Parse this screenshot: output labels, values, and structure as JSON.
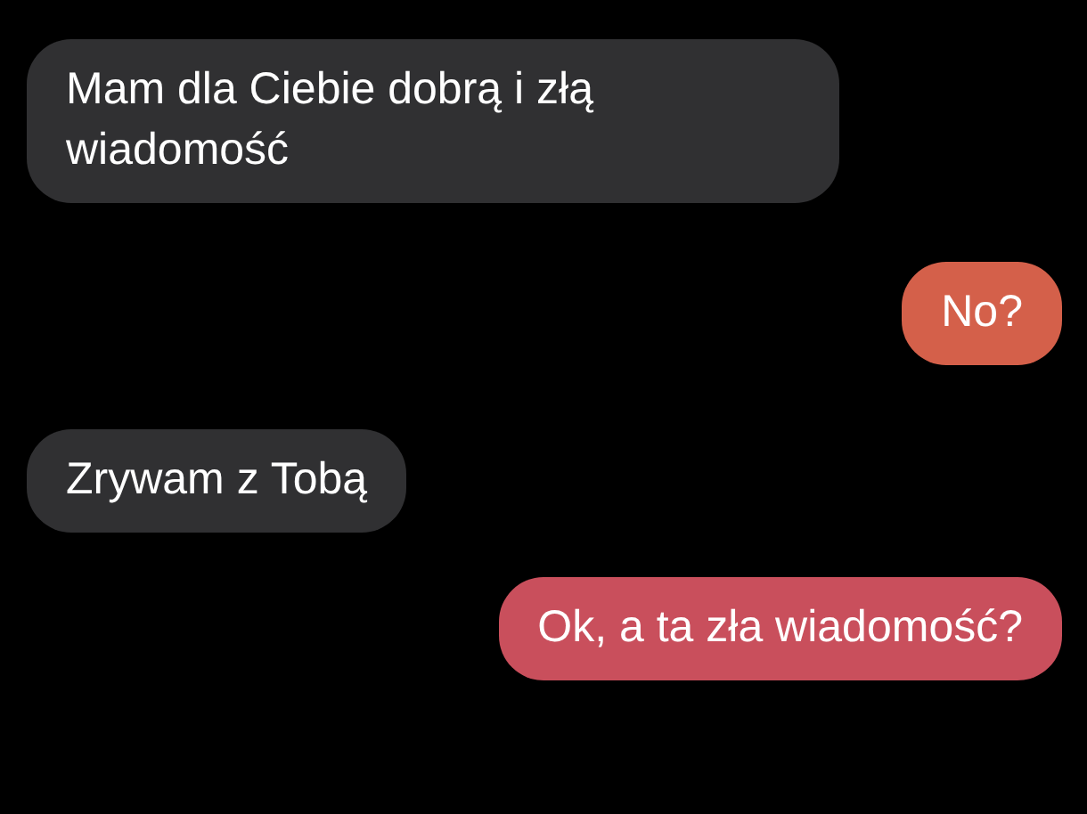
{
  "messages": [
    {
      "text": "Mam dla Ciebie dobrą i złą wiadomość",
      "kind": "incoming",
      "color": "#303032"
    },
    {
      "text": "No?",
      "kind": "outgoing",
      "color": "#d4604a"
    },
    {
      "text": "Zrywam z Tobą",
      "kind": "incoming",
      "color": "#303032"
    },
    {
      "text": "Ok, a ta zła wiadomość?",
      "kind": "outgoing",
      "color": "#c94f5c"
    }
  ]
}
